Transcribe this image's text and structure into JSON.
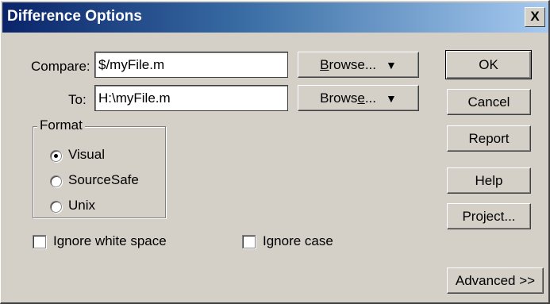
{
  "window": {
    "title": "Difference Options",
    "close_label": "X"
  },
  "compare": {
    "label": "Compare:",
    "value": "$/myFile.m"
  },
  "to": {
    "label": "To:",
    "value": "H:\\myFile.m"
  },
  "browse1": {
    "prefix": "",
    "accel": "B",
    "suffix": "rowse...",
    "arrow": "▼"
  },
  "browse2": {
    "prefix": "Brows",
    "accel": "e",
    "suffix": "...",
    "arrow": "▼"
  },
  "format": {
    "legend": "Format",
    "options": [
      "Visual",
      "SourceSafe",
      "Unix"
    ],
    "selected": "Visual"
  },
  "ignore_white_space": {
    "label": "Ignore white space",
    "checked": false
  },
  "ignore_case": {
    "label": "Ignore case",
    "checked": false
  },
  "buttons": {
    "ok": "OK",
    "cancel": "Cancel",
    "report": "Report",
    "help": "Help",
    "project": "Project...",
    "advanced": "Advanced >>"
  },
  "colors": {
    "dialog_bg": "#d4d0c8",
    "title_start": "#0a246a",
    "title_end": "#a6caf0"
  }
}
